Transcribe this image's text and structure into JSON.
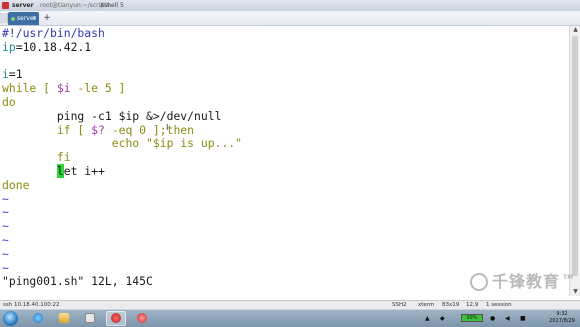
{
  "window": {
    "title": "server",
    "path": "root@tianyun:~/scripts",
    "app": "Xshell 5"
  },
  "tabs": [
    {
      "label": "server"
    }
  ],
  "tab_add_label": "+",
  "editor": {
    "lines": [
      {
        "segments": [
          {
            "text": "#!/usr/bin/bash",
            "color": "blue"
          }
        ]
      },
      {
        "segments": [
          {
            "text": "ip",
            "color": "teal"
          },
          {
            "text": "=10.18.42.1",
            "color": "black"
          }
        ]
      },
      {
        "segments": []
      },
      {
        "segments": [
          {
            "text": "i",
            "color": "teal"
          },
          {
            "text": "=1",
            "color": "black"
          }
        ]
      },
      {
        "segments": [
          {
            "text": "while",
            "color": "olive"
          },
          {
            "text": " [ ",
            "color": "olive"
          },
          {
            "text": "$i",
            "color": "magenta"
          },
          {
            "text": " -le 5 ]",
            "color": "olive"
          }
        ]
      },
      {
        "segments": [
          {
            "text": "do",
            "color": "olive"
          }
        ]
      },
      {
        "segments": [
          {
            "text": "        ping -c1 $ip &>/dev/null",
            "color": "black"
          }
        ]
      },
      {
        "segments": [
          {
            "text": "        if [ ",
            "color": "olive"
          },
          {
            "text": "$?",
            "color": "magenta"
          },
          {
            "text": " -eq 0 ];then",
            "color": "olive"
          }
        ]
      },
      {
        "segments": [
          {
            "text": "                echo \"$ip is up...\"",
            "color": "olive"
          }
        ]
      },
      {
        "segments": [
          {
            "text": "        fi",
            "color": "olive"
          }
        ]
      },
      {
        "segments": [
          {
            "text": "        ",
            "color": "black"
          },
          {
            "text": "l",
            "color": "cursor"
          },
          {
            "text": "et i++",
            "color": "black"
          }
        ]
      },
      {
        "segments": [
          {
            "text": "done",
            "color": "olive"
          }
        ]
      },
      {
        "segments": [
          {
            "text": "~",
            "color": "vim"
          }
        ]
      },
      {
        "segments": [
          {
            "text": "~",
            "color": "vim"
          }
        ]
      },
      {
        "segments": [
          {
            "text": "~",
            "color": "vim"
          }
        ]
      },
      {
        "segments": [
          {
            "text": "~",
            "color": "vim"
          }
        ]
      },
      {
        "segments": [
          {
            "text": "~",
            "color": "vim"
          }
        ]
      },
      {
        "segments": [
          {
            "text": "~",
            "color": "vim"
          }
        ]
      },
      {
        "segments": [
          {
            "text": "\"ping001.sh\" 12L, 145C",
            "color": "black"
          }
        ]
      }
    ]
  },
  "statusbar": {
    "host": "ssh 10.18.40.100:22",
    "protocol": "SSH2",
    "term": "xterm",
    "size": "83x19",
    "position": "12,9",
    "sessions": "1 session"
  },
  "watermark": {
    "text": "千锋教育",
    "tm": "TM"
  },
  "taskbar": {
    "battery_pct": "99%",
    "battery_fill": 0.99,
    "time": "9:32",
    "date": "2017/8/29"
  },
  "colors": {
    "blue": "#3434b8",
    "teal": "#1f8d96",
    "olive": "#8c8c12",
    "magenta": "#a33aa3",
    "vim_tilde": "#3e3ecf",
    "cursor": "#2fd23a",
    "tab_active": "#3d6fa6"
  }
}
